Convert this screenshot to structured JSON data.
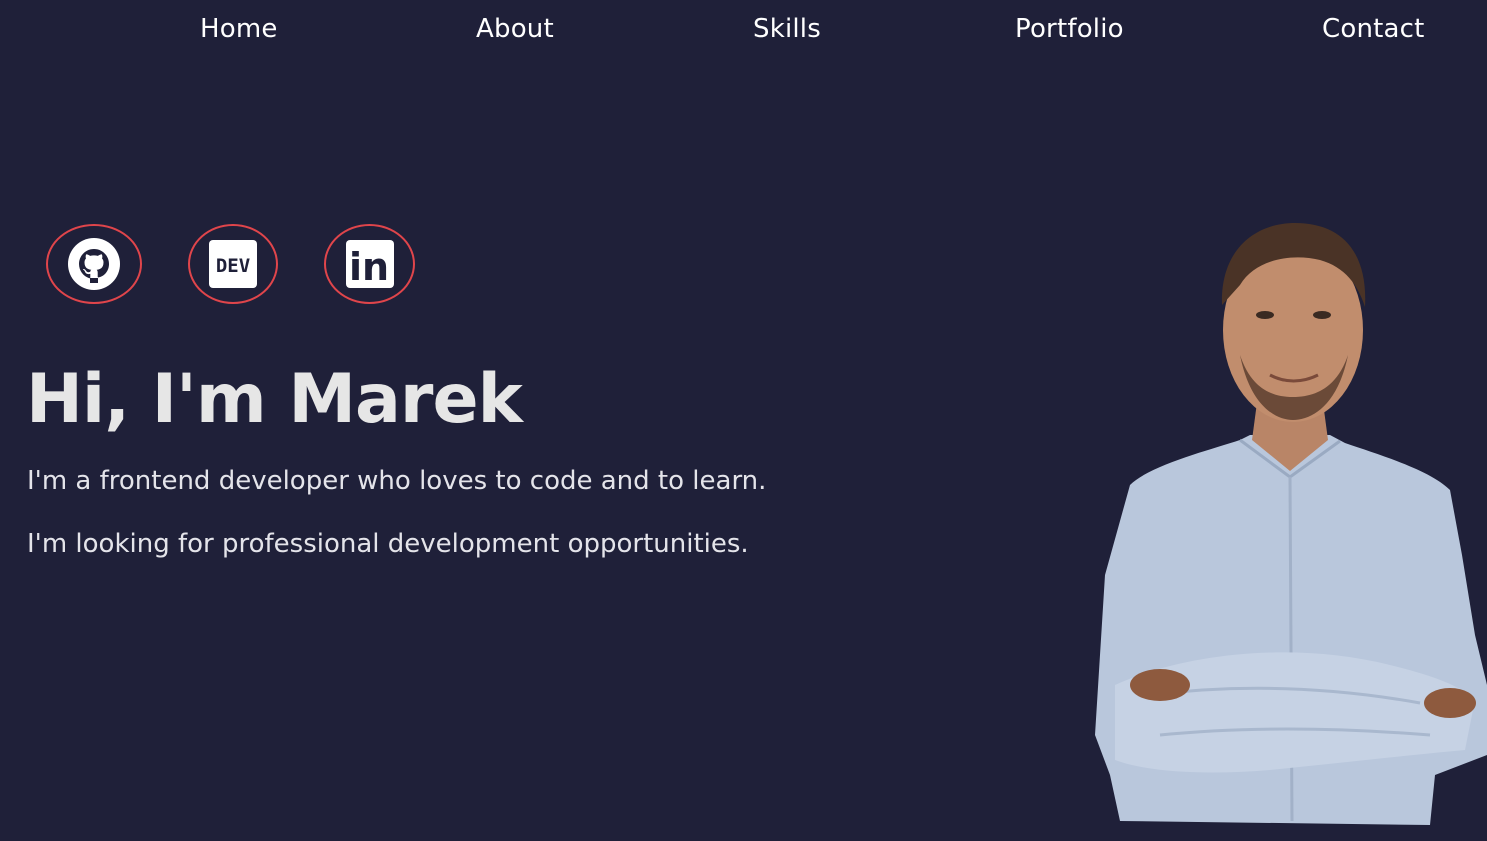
{
  "nav": {
    "items": [
      "Home",
      "About",
      "Skills",
      "Portfolio",
      "Contact"
    ]
  },
  "social": {
    "items": [
      {
        "name": "github",
        "icon": "github-icon"
      },
      {
        "name": "dev",
        "icon": "dev-icon",
        "text": "DEV"
      },
      {
        "name": "linkedin",
        "icon": "linkedin-icon",
        "text": "in"
      }
    ]
  },
  "hero": {
    "title": "Hi, I'm Marek",
    "line1": "I'm a frontend developer who loves to code and to learn.",
    "line2": "I'm looking for professional development opportunities."
  },
  "colors": {
    "background": "#1f2039",
    "accent": "#e0454b",
    "text": "#e6e6e6"
  }
}
